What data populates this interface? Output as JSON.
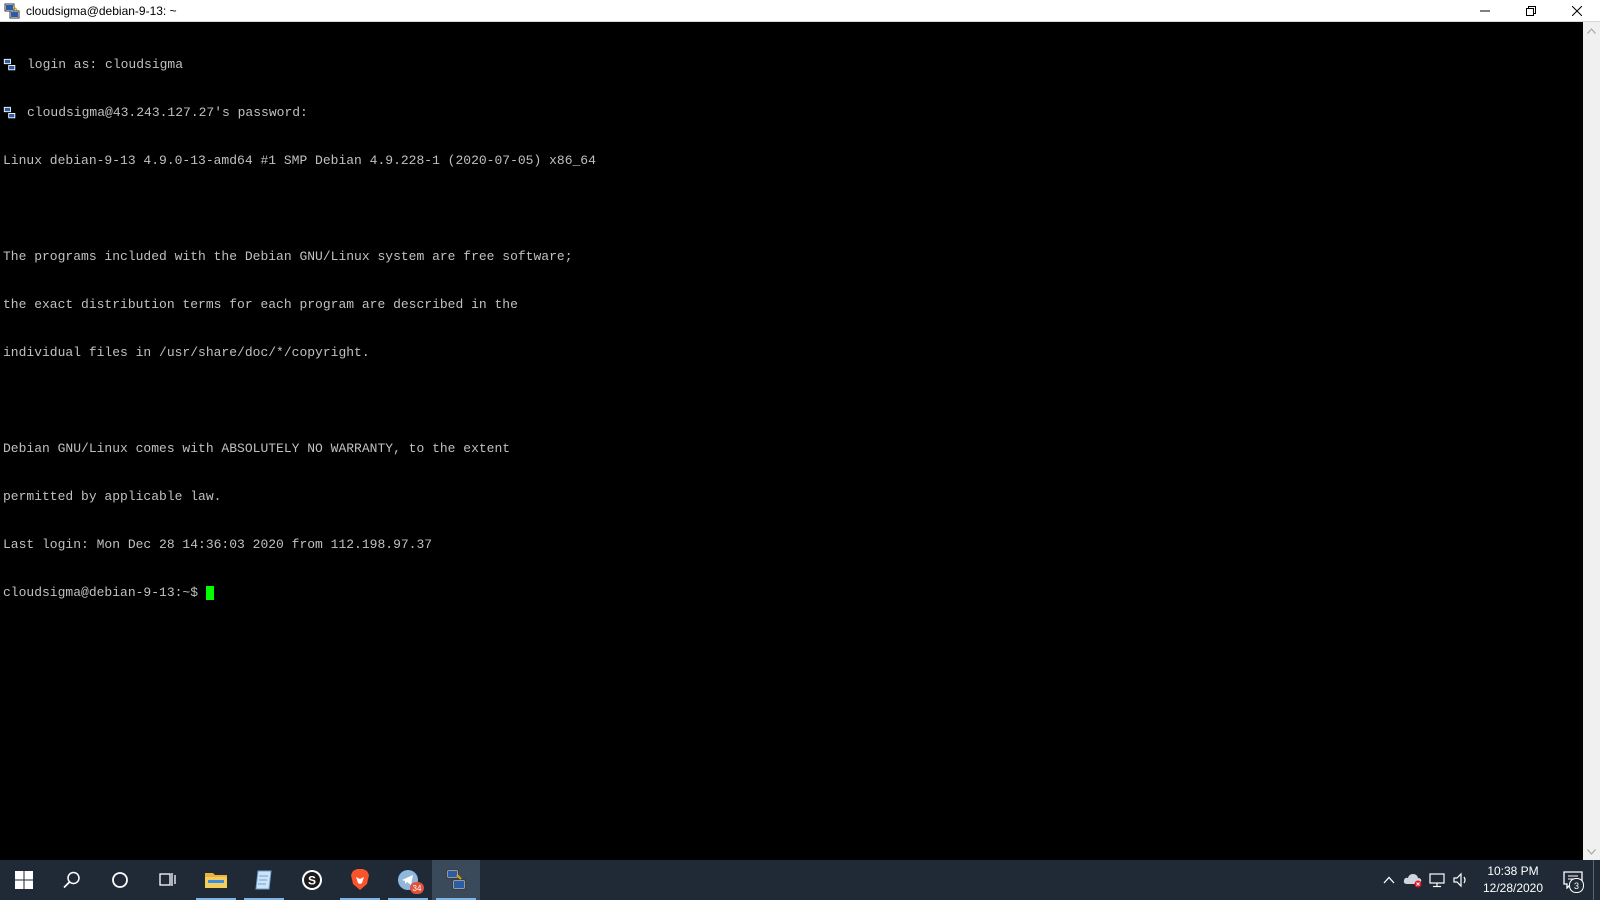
{
  "window": {
    "title": "cloudsigma@debian-9-13: ~"
  },
  "terminal": {
    "lines": [
      {
        "text": "login as: cloudsigma",
        "icon": "putty-icon"
      },
      {
        "text": "cloudsigma@43.243.127.27's password:",
        "icon": "putty-icon"
      },
      {
        "text": "Linux debian-9-13 4.9.0-13-amd64 #1 SMP Debian 4.9.228-1 (2020-07-05) x86_64"
      },
      {
        "text": ""
      },
      {
        "text": "The programs included with the Debian GNU/Linux system are free software;"
      },
      {
        "text": "the exact distribution terms for each program are described in the"
      },
      {
        "text": "individual files in /usr/share/doc/*/copyright."
      },
      {
        "text": ""
      },
      {
        "text": "Debian GNU/Linux comes with ABSOLUTELY NO WARRANTY, to the extent"
      },
      {
        "text": "permitted by applicable law."
      },
      {
        "text": "Last login: Mon Dec 28 14:36:03 2020 from 112.198.97.37"
      }
    ],
    "prompt": "cloudsigma@debian-9-13:~$",
    "text_color": "#c0c0c0",
    "cursor_color": "#00ff00"
  },
  "taskbar": {
    "apps": [
      {
        "name": "start-button",
        "icon": "windows-logo-icon"
      },
      {
        "name": "search-button",
        "icon": "search-icon"
      },
      {
        "name": "cortana-button",
        "icon": "cortana-circle-icon"
      },
      {
        "name": "task-view-button",
        "icon": "task-view-icon"
      },
      {
        "name": "file-explorer",
        "icon": "folder-icon"
      },
      {
        "name": "notepad",
        "icon": "notepad-icon"
      },
      {
        "name": "skype",
        "icon": "skype-icon"
      },
      {
        "name": "brave-browser",
        "icon": "brave-lion-icon"
      },
      {
        "name": "telegram",
        "icon": "telegram-icon",
        "badge": "34"
      },
      {
        "name": "putty",
        "icon": "putty-icon"
      }
    ],
    "tray": {
      "time": "10:38 PM",
      "date": "12/28/2020",
      "notification_count": "3"
    }
  }
}
